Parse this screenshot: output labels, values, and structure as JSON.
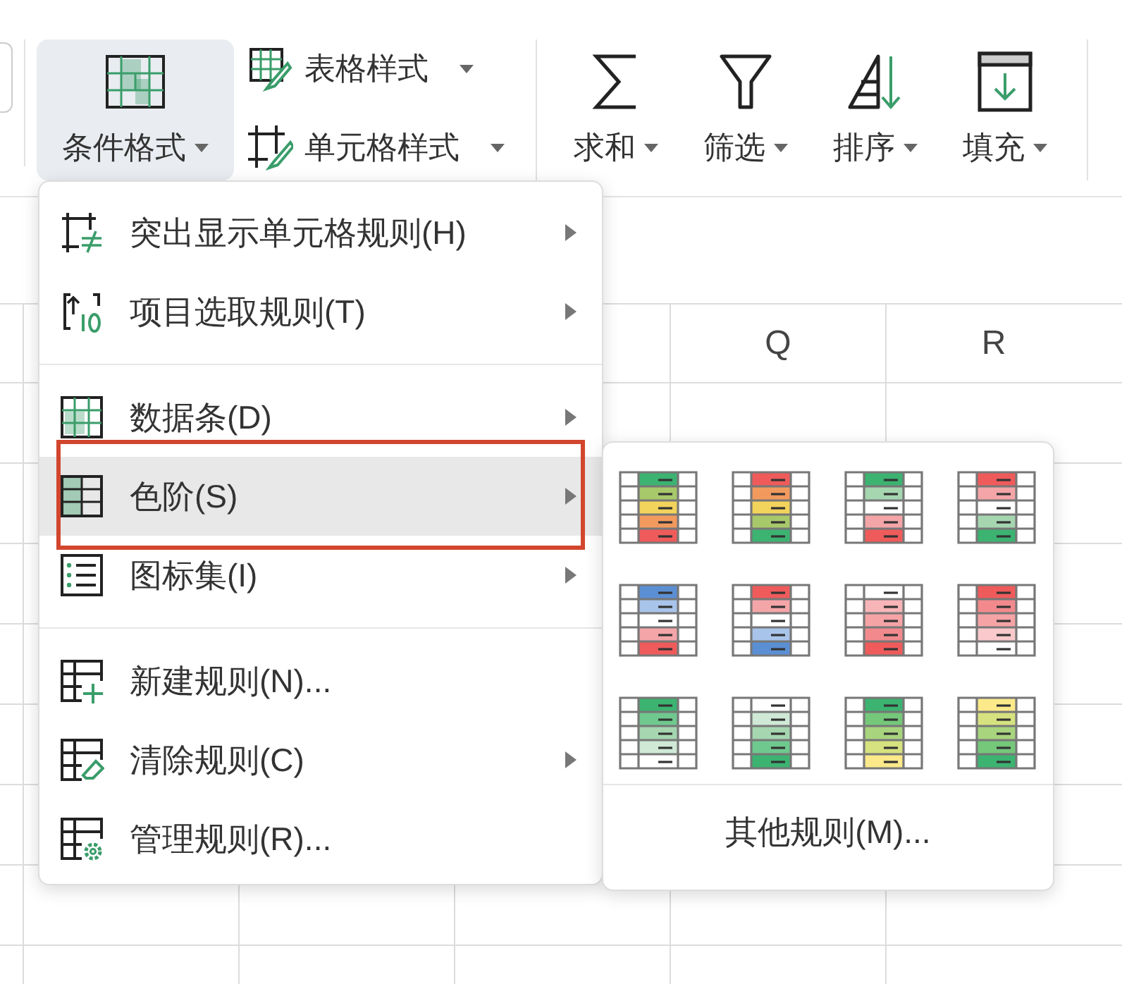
{
  "ribbon": {
    "main_button": {
      "label": "条件格式",
      "selected": true
    },
    "style_buttons": [
      {
        "label": "表格样式",
        "kind": "table-brush"
      },
      {
        "label": "单元格样式",
        "kind": "cell-brush"
      }
    ],
    "tools": [
      {
        "label": "求和",
        "kind": "sum"
      },
      {
        "label": "筛选",
        "kind": "filter"
      },
      {
        "label": "排序",
        "kind": "sort"
      },
      {
        "label": "填充",
        "kind": "fill"
      }
    ]
  },
  "sheet": {
    "column_headers": [
      "Q",
      "R"
    ]
  },
  "menu": {
    "groups": [
      {
        "items": [
          {
            "label": "突出显示单元格规则(H)",
            "kind": "highlight",
            "submenu": true,
            "selected": false,
            "highlighted": false
          },
          {
            "label": "项目选取规则(T)",
            "kind": "top10",
            "submenu": true,
            "selected": false,
            "highlighted": false
          }
        ]
      },
      {
        "items": [
          {
            "label": "数据条(D)",
            "kind": "databar",
            "submenu": true,
            "selected": false,
            "highlighted": false
          },
          {
            "label": "色阶(S)",
            "kind": "colorscale",
            "submenu": true,
            "selected": true,
            "highlighted": true
          },
          {
            "label": "图标集(I)",
            "kind": "iconset",
            "submenu": true,
            "selected": false,
            "highlighted": false
          }
        ]
      },
      {
        "items": [
          {
            "label": "新建规则(N)...",
            "kind": "newrule",
            "submenu": false,
            "selected": false,
            "highlighted": false
          },
          {
            "label": "清除规则(C)",
            "kind": "clearrule",
            "submenu": true,
            "selected": false,
            "highlighted": false
          },
          {
            "label": "管理规则(R)...",
            "kind": "managerule",
            "submenu": false,
            "selected": false,
            "highlighted": false
          }
        ]
      }
    ]
  },
  "color_scales": {
    "swatches": [
      {
        "cells": [
          {
            "color": "#3cb371"
          },
          {
            "color": "#a8c96a"
          },
          {
            "color": "#f2d35b"
          },
          {
            "color": "#f29a5e"
          },
          {
            "color": "#ef5b5b"
          }
        ]
      },
      {
        "cells": [
          {
            "color": "#ef5b5b"
          },
          {
            "color": "#f29a5e"
          },
          {
            "color": "#f2d35b"
          },
          {
            "color": "#a8c96a"
          },
          {
            "color": "#3cb371"
          }
        ]
      },
      {
        "cells": [
          {
            "color": "#3cb371"
          },
          {
            "color": "#a5d6b0"
          },
          {
            "color": "#ffffff"
          },
          {
            "color": "#f4a5a8"
          },
          {
            "color": "#ef5b5b"
          }
        ]
      },
      {
        "cells": [
          {
            "color": "#ef5b5b"
          },
          {
            "color": "#f4a5a8"
          },
          {
            "color": "#ffffff"
          },
          {
            "color": "#a5d6b0"
          },
          {
            "color": "#3cb371"
          }
        ]
      },
      {
        "cells": [
          {
            "color": "#5b8fd4"
          },
          {
            "color": "#a9c4ea"
          },
          {
            "color": "#ffffff"
          },
          {
            "color": "#f4a5a8"
          },
          {
            "color": "#ef5b5b"
          }
        ]
      },
      {
        "cells": [
          {
            "color": "#ef5b5b"
          },
          {
            "color": "#f4a5a8"
          },
          {
            "color": "#ffffff"
          },
          {
            "color": "#a9c4ea"
          },
          {
            "color": "#5b8fd4"
          }
        ]
      },
      {
        "cells": [
          {
            "color": "#ffffff"
          },
          {
            "color": "#f8b5b8"
          },
          {
            "color": "#f6a3a6"
          },
          {
            "color": "#f28a8d"
          },
          {
            "color": "#ef5b5b"
          }
        ]
      },
      {
        "cells": [
          {
            "color": "#ef5b5b"
          },
          {
            "color": "#f28a8d"
          },
          {
            "color": "#f6a3a6"
          },
          {
            "color": "#f9c9cb"
          },
          {
            "color": "#ffffff"
          }
        ]
      },
      {
        "cells": [
          {
            "color": "#3cb371"
          },
          {
            "color": "#6fc98e"
          },
          {
            "color": "#a5d6b0"
          },
          {
            "color": "#cfe9d6"
          },
          {
            "color": "#ffffff"
          }
        ]
      },
      {
        "cells": [
          {
            "color": "#ffffff"
          },
          {
            "color": "#cfe9d6"
          },
          {
            "color": "#a5d6b0"
          },
          {
            "color": "#6fc98e"
          },
          {
            "color": "#3cb371"
          }
        ]
      },
      {
        "cells": [
          {
            "color": "#3cb371"
          },
          {
            "color": "#75c77a"
          },
          {
            "color": "#a8d47e"
          },
          {
            "color": "#d6e27f"
          },
          {
            "color": "#fbe98a"
          }
        ]
      },
      {
        "cells": [
          {
            "color": "#fbe98a"
          },
          {
            "color": "#d6e27f"
          },
          {
            "color": "#a8d47e"
          },
          {
            "color": "#75c77a"
          },
          {
            "color": "#3cb371"
          }
        ]
      }
    ],
    "footer": "其他规则(M)..."
  }
}
